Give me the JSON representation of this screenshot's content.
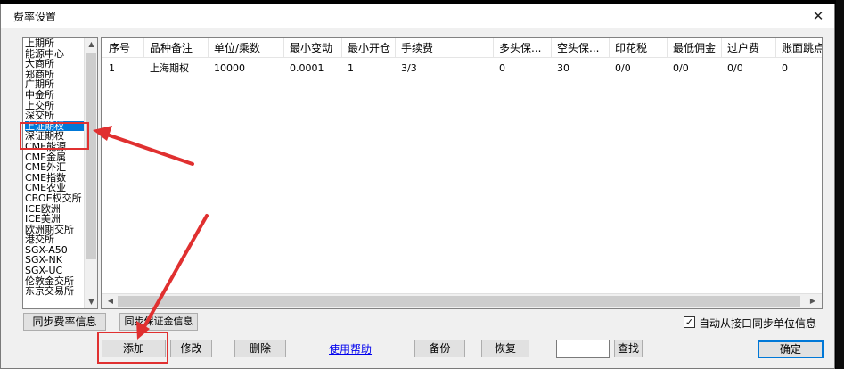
{
  "window": {
    "title": "费率设置"
  },
  "exchanges": [
    "上期所",
    "能源中心",
    "大商所",
    "郑商所",
    "广期所",
    "中金所",
    "上交所",
    "深交所",
    "上证期权",
    "深证期权",
    "CME能源",
    "CME金属",
    "CME外汇",
    "CME指数",
    "CME农业",
    "CBOE权交所",
    "ICE欧洲",
    "ICE美洲",
    "欧洲期交所",
    "港交所",
    "SGX-A50",
    "SGX-NK",
    "SGX-UC",
    "伦敦金交所",
    "东京交易所"
  ],
  "selected_exchange": "上证期权",
  "table": {
    "columns": [
      "序号",
      "品种备注",
      "单位/乘数",
      "最小变动",
      "最小开仓",
      "手续费",
      "多头保...",
      "空头保...",
      "印花税",
      "最低佣金",
      "过户费",
      "账面跳点"
    ],
    "rows": [
      [
        "1",
        "上海期权",
        "10000",
        "0.0001",
        "1",
        "3/3",
        "0",
        "30",
        "0/0",
        "0/0",
        "0/0",
        "0"
      ]
    ]
  },
  "buttons": {
    "sync_rate": "同步费率信息",
    "sync_margin": "同步保证金信息",
    "add": "添加",
    "modify": "修改",
    "delete": "删除",
    "backup": "备份",
    "restore": "恢复",
    "find": "查找",
    "ok": "确定"
  },
  "help_link": "使用帮助",
  "auto_sync": {
    "label": "自动从接口同步单位信息",
    "checked": true
  },
  "search": {
    "value": ""
  },
  "icons": {
    "close": "close-icon",
    "scroll_up": "scroll-up-icon",
    "scroll_down": "scroll-down-icon",
    "scroll_left": "scroll-left-icon",
    "scroll_right": "scroll-right-icon"
  },
  "colors": {
    "selection": "#0078d7",
    "annotation": "#e03030",
    "link": "#0000ee"
  }
}
